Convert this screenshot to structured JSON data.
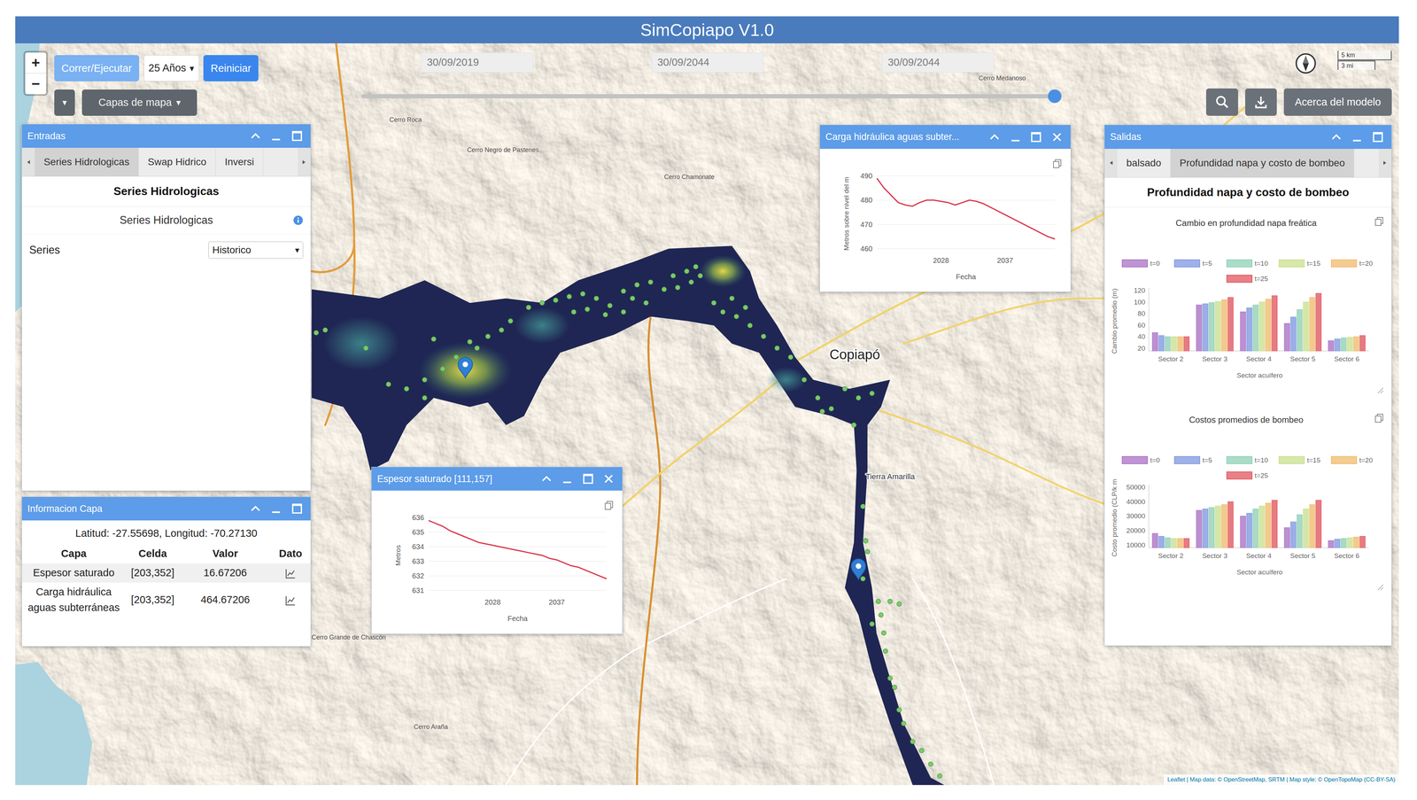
{
  "window": {
    "title": "SimCopiapo V1.0"
  },
  "controls": {
    "zoom_in": "+",
    "zoom_out": "−",
    "run": "Correr/Ejecutar",
    "horizon": "25 Años",
    "horizon_caret": "▾",
    "reset": "Reiniciar",
    "menu_caret": "▾",
    "layers": "Capas de mapa",
    "layers_caret": "▾",
    "about": "Acerca del modelo"
  },
  "timeline": {
    "dates": [
      "30/09/2019",
      "30/09/2044",
      "30/09/2044"
    ],
    "level": 1
  },
  "scale": {
    "metric": "5 km",
    "imperial": "3 mi"
  },
  "map": {
    "labels": [
      {
        "text": "Cerro Roca",
        "kind": "peak"
      },
      {
        "text": "Cerro Negro de Pastenes",
        "kind": "peak"
      },
      {
        "text": "Cerro Chamonate",
        "kind": "peak"
      },
      {
        "text": "Cerro Medanoso",
        "kind": "peak"
      },
      {
        "text": "Copiapó",
        "kind": "city"
      },
      {
        "text": "Tierra Amarilla",
        "kind": "town"
      },
      {
        "text": "Cerro Grande de Chascón",
        "kind": "peak"
      },
      {
        "text": "Cerro Araña",
        "kind": "peak"
      }
    ],
    "attribution": "Leaflet | Map data: © OpenStreetMap, SRTM | Map style: © OpenTopoMap (CC-BY-SA)"
  },
  "inputs": {
    "title": "Entradas",
    "tabs": [
      {
        "label": "Series Hidrologicas",
        "selected": true
      },
      {
        "label": "Swap Hidrico",
        "selected": false
      },
      {
        "label": "Inversi",
        "selected": false
      }
    ],
    "heading": "Series Hidrologicas",
    "subheading": "Series Hidrologicas",
    "field": {
      "label": "Series",
      "value": "Historico",
      "caret": "▾"
    }
  },
  "layer_info": {
    "title": "Informacion Capa",
    "coords": "Latitud: -27.55698, Longitud: -70.27130",
    "columns": [
      "Capa",
      "Celda",
      "Valor",
      "Dato"
    ],
    "rows": [
      {
        "cells": [
          "Espesor saturado",
          "[203,352]",
          "16.67206"
        ],
        "selected": true
      },
      {
        "cells": [
          "Carga hidráulica aguas subterráneas",
          "[203,352]",
          "464.67206"
        ],
        "selected": false
      }
    ]
  },
  "chart_windows": [
    {
      "title": "Carga hidráulica aguas subter...",
      "y_label": "Metros sobre nivel del m",
      "x_label": "Fecha",
      "y_ticks": [
        "490",
        "480",
        "470",
        "460"
      ],
      "x_ticks": [
        "2028",
        "2037"
      ],
      "series": [
        {
          "values": [
            489,
            485,
            482,
            479,
            478,
            477.5,
            479,
            480,
            480,
            479.5,
            479,
            478,
            479,
            480,
            479.5,
            478.5,
            477,
            475.5,
            474,
            472.5,
            471,
            469.5,
            468,
            466.5,
            465,
            464
          ]
        }
      ]
    },
    {
      "title": "Espesor saturado [111,157]",
      "y_label": "Metros",
      "x_label": "Fecha",
      "y_ticks": [
        "636",
        "635",
        "634",
        "633",
        "632",
        "631"
      ],
      "x_ticks": [
        "2028",
        "2037"
      ],
      "series": [
        {
          "values": [
            635.8,
            635.6,
            635.4,
            635.1,
            634.9,
            634.7,
            634.5,
            634.3,
            634.2,
            634.1,
            634.0,
            633.9,
            633.8,
            633.7,
            633.6,
            633.5,
            633.4,
            633.2,
            633.1,
            632.9,
            632.7,
            632.6,
            632.4,
            632.2,
            632.0,
            631.8
          ]
        }
      ]
    }
  ],
  "outputs": {
    "title": "Salidas",
    "tabs": [
      {
        "label": "balsado",
        "selected": false
      },
      {
        "label": "Profundidad napa y costo de bombeo",
        "selected": true
      }
    ],
    "heading": "Profundidad napa y costo de bombeo",
    "charts": [
      {
        "title": "Cambio en profundidad napa freática",
        "y_label": "Cambio promedio (m)",
        "x_label": "Sector acuífero",
        "y_ticks": [
          "120",
          "100",
          "80",
          "60",
          "40",
          "20"
        ],
        "categories": [
          "Sector 2",
          "Sector 3",
          "Sector 4",
          "Sector 5",
          "Sector 6"
        ],
        "series": [
          {
            "name": "t=0",
            "color": "#a970c4",
            "values": [
              47,
              95,
              83,
              63,
              33
            ]
          },
          {
            "name": "t=5",
            "color": "#7f97e0",
            "values": [
              42,
              97,
              90,
              74,
              36
            ]
          },
          {
            "name": "t=10",
            "color": "#8fd0b6",
            "values": [
              40,
              99,
              95,
              87,
              38
            ]
          },
          {
            "name": "t=15",
            "color": "#c9e08e",
            "values": [
              40,
              101,
              100,
              100,
              39
            ]
          },
          {
            "name": "t=20",
            "color": "#f0bb6c",
            "values": [
              40,
              104,
              105,
              108,
              40
            ]
          },
          {
            "name": "t=25",
            "color": "#e0565f",
            "values": [
              40,
              108,
              111,
              115,
              42
            ]
          }
        ]
      },
      {
        "title": "Costos promedios de bombeo",
        "y_label": "Costo promedio (CLP/k m",
        "x_label": "Sector acuífero",
        "y_ticks": [
          "50000",
          "40000",
          "30000",
          "20000",
          "10000"
        ],
        "categories": [
          "Sector 2",
          "Sector 3",
          "Sector 4",
          "Sector 5",
          "Sector 6"
        ],
        "series": [
          {
            "name": "t=0",
            "color": "#a970c4",
            "values": [
              18000,
              34000,
              30000,
              22000,
              13000
            ]
          },
          {
            "name": "t=5",
            "color": "#7f97e0",
            "values": [
              16000,
              35000,
              32000,
              26000,
              14000
            ]
          },
          {
            "name": "t=10",
            "color": "#8fd0b6",
            "values": [
              15000,
              36000,
              35000,
              31000,
              14500
            ]
          },
          {
            "name": "t=15",
            "color": "#c9e08e",
            "values": [
              14500,
              37000,
              37000,
              35000,
              15000
            ]
          },
          {
            "name": "t=20",
            "color": "#f0bb6c",
            "values": [
              14500,
              38000,
              39000,
              38000,
              15500
            ]
          },
          {
            "name": "t=25",
            "color": "#e0565f",
            "values": [
              14500,
              40000,
              41000,
              41000,
              16000
            ]
          }
        ]
      }
    ]
  }
}
